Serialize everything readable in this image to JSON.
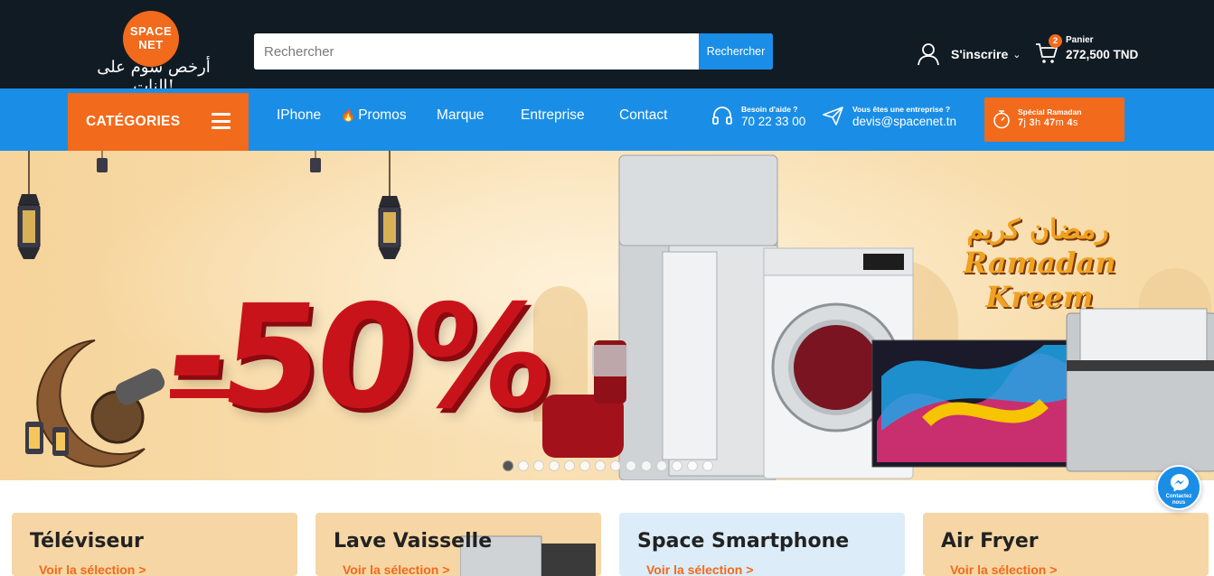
{
  "header": {
    "logo": {
      "line1": "SPACE",
      "line2": "NET",
      "tagline": "أرخص سوم على النات!"
    },
    "search": {
      "placeholder": "Rechercher",
      "button_label": "Rechercher"
    },
    "account": {
      "label": "S'inscrire",
      "icon": "user-icon"
    },
    "cart": {
      "count": "2",
      "label": "Panier",
      "total": "272,500 TND",
      "icon": "cart-icon"
    }
  },
  "nav": {
    "categories_label": "CATÉGORIES",
    "links": [
      {
        "label": "IPhone"
      },
      {
        "label": "Promos",
        "icon": "flame-icon"
      },
      {
        "label": "Marque"
      },
      {
        "label": "Entreprise"
      },
      {
        "label": "Contact"
      }
    ],
    "help": {
      "small": "Besoin d'aide ?",
      "big": "70 22 33 00",
      "icon": "headset-icon"
    },
    "business": {
      "small": "Vous êtes une entreprise ?",
      "big": "devis@spacenet.tn",
      "icon": "paper-plane-icon"
    },
    "ramadan": {
      "title": "Spécial Ramadan",
      "days": "7",
      "days_unit": "j",
      "hours": "3",
      "hours_unit": "h",
      "minutes": "47",
      "minutes_unit": "m",
      "seconds": "4",
      "seconds_unit": "s",
      "icon": "stopwatch-icon"
    }
  },
  "hero": {
    "discount": "-50%",
    "greeting_arabic": "رمضان كريم",
    "greeting_latin": "Ramadan Kreem",
    "slide_count": 14,
    "active_slide": 1
  },
  "cards": [
    {
      "title": "Téléviseur",
      "link": "Voir la sélection >",
      "bg": "#f6d6a4"
    },
    {
      "title": "Lave Vaisselle",
      "link": "Voir la sélection >",
      "bg": "#f6d6a4"
    },
    {
      "title": "Space Smartphone",
      "link": "Voir la sélection >",
      "bg": "#dcecf8"
    },
    {
      "title": "Air Fryer",
      "link": "Voir la sélection >",
      "bg": "#f6d6a4"
    }
  ],
  "messenger": {
    "label_line1": "Contactez",
    "label_line2": "nous",
    "icon": "messenger-icon"
  },
  "colors": {
    "dark": "#111b24",
    "blue": "#1a8ee6",
    "orange": "#f26a1b",
    "red": "#c9131b"
  }
}
